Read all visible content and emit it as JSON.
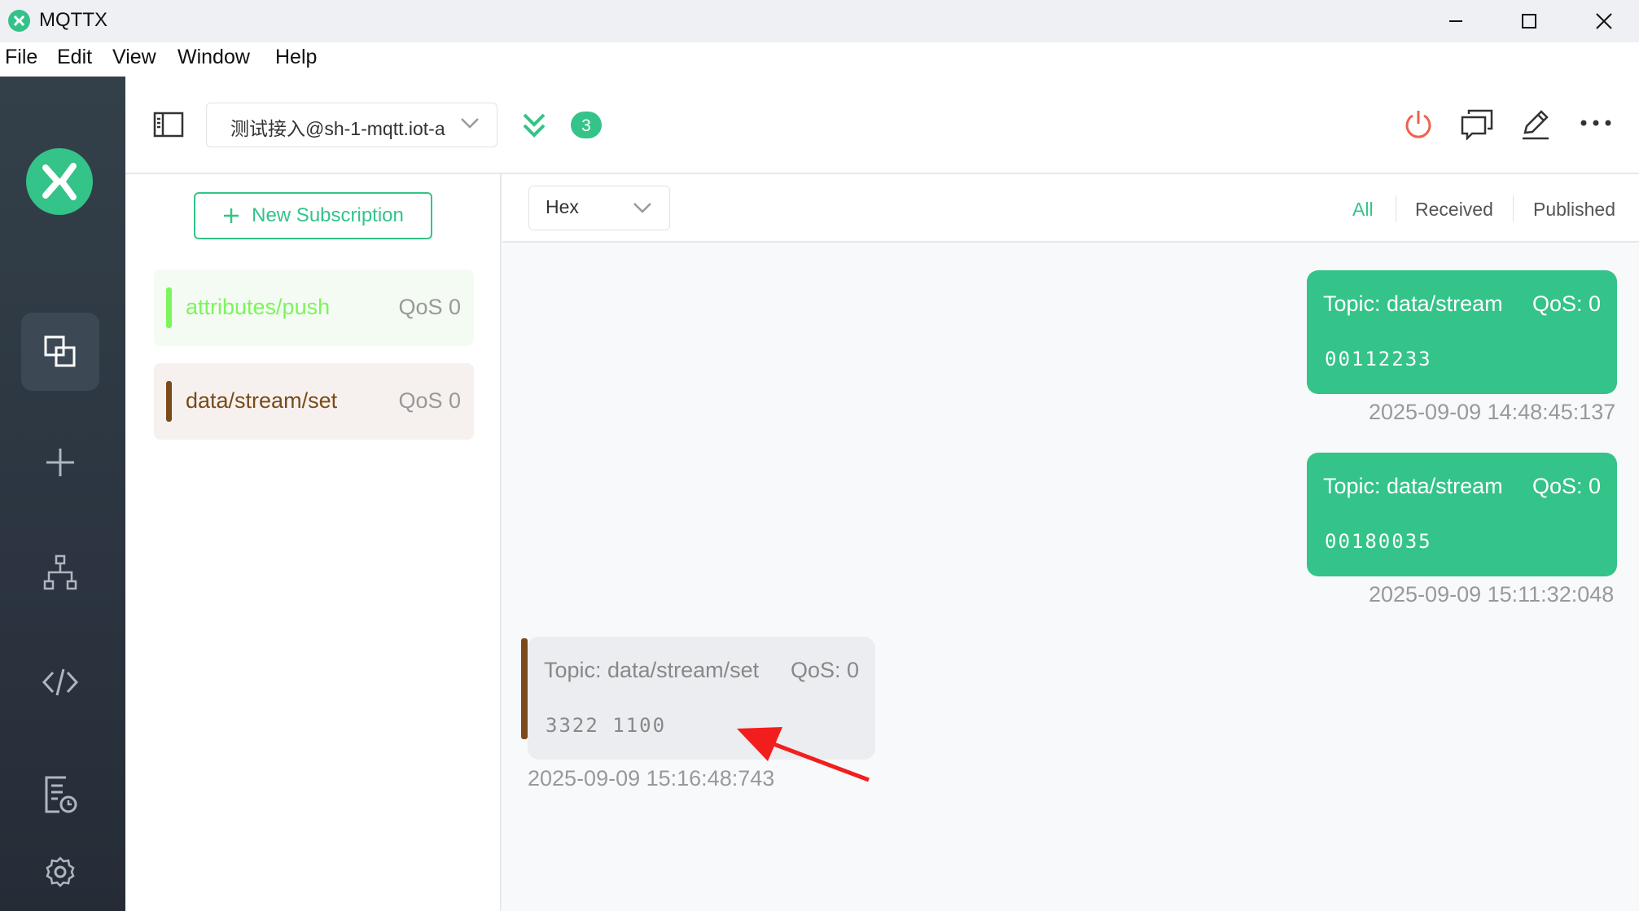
{
  "window": {
    "title": "MQTTX"
  },
  "menu": [
    "File",
    "Edit",
    "View",
    "Window",
    "Help"
  ],
  "toolbar": {
    "connection_name": "测试接入@sh-1-mqtt.iot-a",
    "badge_count": "3"
  },
  "subscriptions": {
    "new_label": "New Subscription",
    "items": [
      {
        "topic": "attributes/push",
        "qos": "QoS 0",
        "color": "#7cf45c",
        "bg": "#f4fbf3"
      },
      {
        "topic": "data/stream/set",
        "qos": "QoS 0",
        "color": "#7a4a1a",
        "bg": "#f6f1ee"
      }
    ]
  },
  "messages": {
    "format": "Hex",
    "filters": [
      "All",
      "Received",
      "Published"
    ],
    "active_filter": "All",
    "items": [
      {
        "direction": "published",
        "topic": "Topic: data/stream",
        "qos": "QoS: 0",
        "payload": "00112233",
        "time": "2025-09-09 14:48:45:137"
      },
      {
        "direction": "published",
        "topic": "Topic: data/stream",
        "qos": "QoS: 0",
        "payload": "00180035",
        "time": "2025-09-09 15:11:32:048"
      },
      {
        "direction": "received",
        "topic": "Topic: data/stream/set",
        "qos": "QoS: 0",
        "payload": "3322 1100",
        "time": "2025-09-09 15:16:48:743"
      }
    ]
  },
  "colors": {
    "accent": "#34c388",
    "danger": "#f0604d",
    "rail": "#2b3440",
    "annotation_arrow": "#f21e1e"
  }
}
